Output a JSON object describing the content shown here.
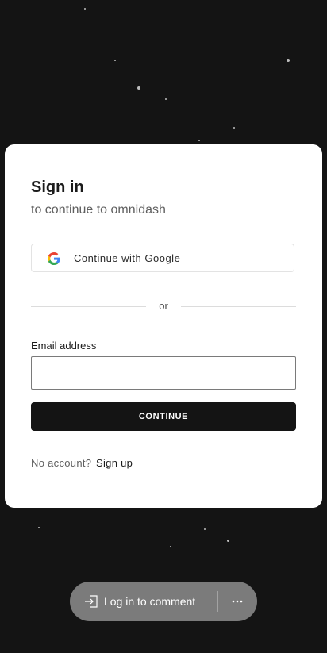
{
  "signin": {
    "title": "Sign in",
    "subtitle": "to continue to omnidash",
    "google_button_label": "Continue with Google",
    "divider_text": "or",
    "email_label": "Email address",
    "email_value": "",
    "continue_label": "CONTINUE",
    "no_account_text": "No account?",
    "signup_label": "Sign up"
  },
  "comment_bar": {
    "login_label": "Log in to comment",
    "login_icon": "login-icon",
    "more_icon": "more-horizontal-icon"
  },
  "colors": {
    "background": "#141414",
    "card": "#ffffff",
    "primary_button": "#141414",
    "pill": "#7b7b7b"
  }
}
